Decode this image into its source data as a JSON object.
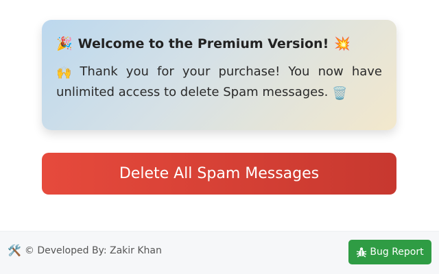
{
  "welcome": {
    "title_emoji_left": "🎉",
    "title": "Welcome to the Premium Version!",
    "title_emoji_right": "💥",
    "text_emoji_lead": "🙌",
    "text": "Thank you for your purchase! You now have unlimited access to delete Spam messages.",
    "text_emoji_trail": "🗑️"
  },
  "actions": {
    "delete_label": "Delete All Spam Messages"
  },
  "footer": {
    "credit_emoji": "🛠️",
    "credit": "© Developed By: Zakir Khan",
    "bug_report_label": "Bug Report",
    "bug_icon": "bug-icon"
  },
  "colors": {
    "delete_button": "#e64a3c",
    "bug_button": "#2f9c44"
  }
}
